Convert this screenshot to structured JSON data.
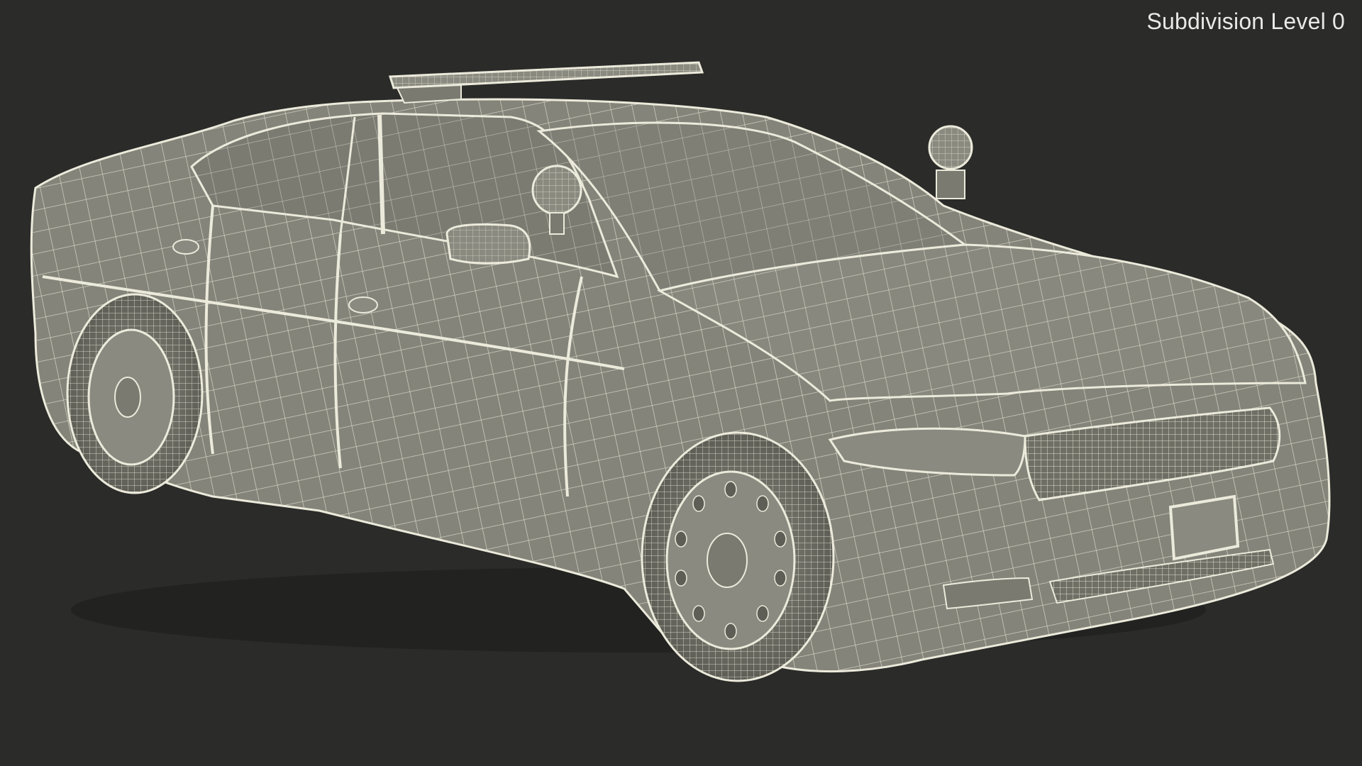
{
  "viewport": {
    "label": "Subdivision Level 0",
    "colors": {
      "background": "#2b2b29",
      "surface": "#84847a",
      "surface_shadow": "#6f6f66",
      "wire": "#eceadb",
      "label": "#e9e9e6"
    }
  },
  "model": {
    "icon": "police-car-wireframe"
  }
}
